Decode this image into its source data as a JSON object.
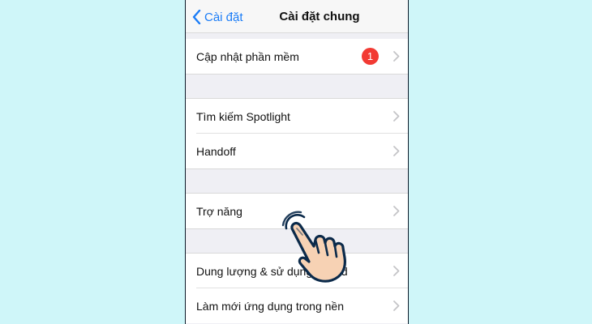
{
  "navbar": {
    "back_label": "Cài đặt",
    "title": "Cài đặt chung"
  },
  "rows": {
    "software_update": {
      "label": "Cập nhật phần mềm",
      "badge": "1"
    },
    "spotlight": {
      "label": "Tìm kiếm Spotlight"
    },
    "handoff": {
      "label": "Handoff"
    },
    "accessibility": {
      "label": "Trợ năng"
    },
    "storage": {
      "label": "Dung lượng & sử dụng iCloud"
    },
    "background_refresh": {
      "label": "Làm mới ứng dụng trong nền"
    }
  },
  "colors": {
    "accent": "#1a7cf7",
    "badge": "#f23a33",
    "background": "#cff6f9",
    "hand_fill": "#f7d2b4",
    "hand_outline": "#0b2a4a"
  },
  "icons": [
    "chevron-left-icon",
    "chevron-right-icon",
    "tap-hand-icon"
  ]
}
